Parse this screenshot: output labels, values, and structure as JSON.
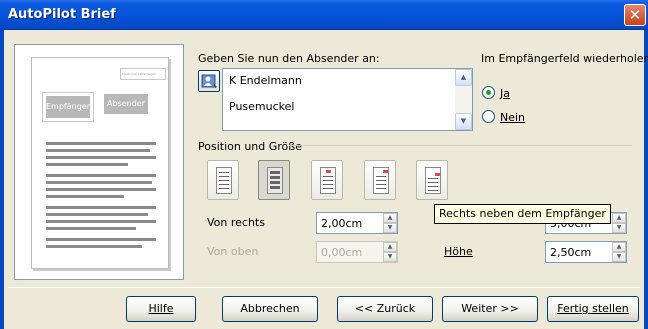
{
  "window": {
    "title": "AutoPilot Brief",
    "close_glyph": "✕"
  },
  "preview": {
    "recipient_label": "Empfänger",
    "sender_label": "Absender",
    "stamp_text": "Elektronik Leiterwagen"
  },
  "sender": {
    "label": "Geben Sie nun den Absender an:",
    "lines": [
      "K Endelmann",
      "Pusemuckel"
    ],
    "address_book_icon": "address-book-icon"
  },
  "repeat": {
    "label": "Im Empfängerfeld wiederholen?",
    "options": [
      "Ja",
      "Nein"
    ],
    "selected": "Ja"
  },
  "position": {
    "label": "Position und Größe",
    "preset_icons": [
      "left-top-icon",
      "left-bold-icon",
      "centered-icon",
      "right-top-icon",
      "right-beside-recipient-icon"
    ],
    "tooltip": "Rechts neben dem Empfänger",
    "from_right_label": "Von rechts",
    "from_right_value": "2,00cm",
    "from_top_label": "Von oben",
    "from_top_value": "0,00cm",
    "width_value": "5,00cm",
    "height_label": "Höhe",
    "height_value": "2,50cm"
  },
  "buttons": {
    "help": "Hilfe",
    "cancel": "Abbrechen",
    "back": "<< Zurück",
    "next": "Weiter >>",
    "finish": "Fertig stellen"
  }
}
